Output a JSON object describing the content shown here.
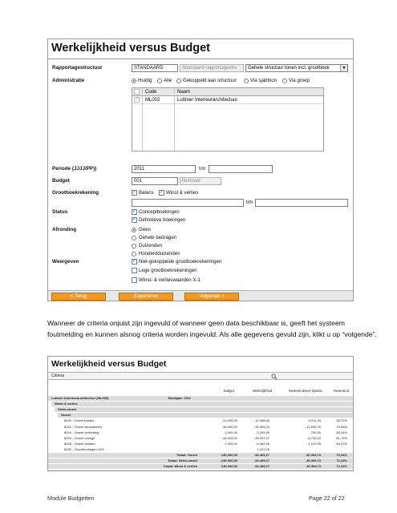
{
  "form": {
    "title": "Werkelijkheid versus Budget",
    "labels": {
      "rapportagestructuur": "Rapportagestructuur",
      "administratie": "Administratie",
      "periode": "Periode (JJJJ/PP))",
      "budget": "Budget",
      "grootboekrekening": "Grootboekrekening",
      "status": "Status",
      "afronding": "Afronding",
      "weergeven": "Weergeven"
    },
    "rapportagestructuur": {
      "code": "STANDAARD",
      "description": "Standaard rapportagestru",
      "option": "Gehele structuur tonen incl. grootboek"
    },
    "administratie_options": [
      "Huidig",
      "Alle",
      "Gekoppeld aan structuur",
      "Via sjabloon",
      "Via groep"
    ],
    "admin_grid": {
      "headers": [
        "Code",
        "Naam"
      ],
      "rows": [
        {
          "code": "ML002",
          "naam": "Luttmer Interieurarchitectuur"
        }
      ]
    },
    "periode": {
      "from": "2011",
      "to_label": "t/m"
    },
    "budget": {
      "code": "001",
      "name": "Normaal"
    },
    "grootboek": {
      "options": [
        "Balans",
        "Winst & verlies"
      ],
      "to_label": "t/m"
    },
    "status_options": [
      "Conceptboekingen",
      "Definitieve boekingen"
    ],
    "afronding_options": [
      "Geen",
      "Gehele bedragen",
      "Duizenden",
      "Honderdduizenden"
    ],
    "weergeven_options": [
      "Niet-gekoppelde grootboekrekeningen",
      "Lege grootboekrekeningen",
      "Winst- & verlieswaarden X-1"
    ],
    "buttons": {
      "back": "< Terug",
      "export": "Exporteren",
      "next": "Volgende >"
    }
  },
  "paragraph": [
    "Wanneer de criteria onjuist zijn ingevuld of wanneer geen data beschikbaar is, geeft het systeem",
    "foutmelding en kunnen alsnog criteria worden ingevuld. Als alle gegevens gevuld zijn, klikt u op “volgende”."
  ],
  "report": {
    "title": "Werkelijkheid versus Budget",
    "criteria_label": "Criteria",
    "columns": [
      "Budget",
      "Werkelijkheid",
      "Resterend/over tijdsste",
      "Resterend"
    ],
    "entity": {
      "name": "Luttmer Interieurarchitectuur (ML002)",
      "note": "Boekjaar: 2011"
    },
    "groups": [
      "Winst & verlies",
      "Netto-omzet",
      "Omzet"
    ],
    "rows": [
      {
        "label": "8020 - Omzet kasten",
        "budget": "-24.000,00",
        "actual": "-14.088,66",
        "diff": "-9.911,34",
        "pct": "58,70%"
      },
      {
        "label": "8022 - Omzet zitmeubelen",
        "budget": "-48.000,00",
        "actual": "-35.309,24",
        "diff": "-12.690,76",
        "pct": "73,56%"
      },
      {
        "label": "8024 - Omzet verlichting",
        "budget": "-3.000,00",
        "actual": "-2.205,50",
        "diff": "-794,50",
        "pct": "68,04%"
      },
      {
        "label": "8026 - Omzet overige",
        "budget": "-48.000,00",
        "actual": "-39.257,97",
        "diff": "-8.742,03",
        "pct": "81,79%"
      },
      {
        "label": "8028 - Omzet bedden",
        "budget": "-7.200,00",
        "actual": "-6.062,95",
        "diff": "-1.137,05",
        "pct": "84,21%"
      },
      {
        "label": "8030 - Omzetkortingen 10%",
        "budget": "",
        "actual": "2.437,05",
        "diff": "",
        "pct": ""
      }
    ],
    "totals": [
      {
        "label": "Totaal: Omzet",
        "budget": "-130.000,00",
        "actual": "-94.469,27",
        "diff": "-36.309,73",
        "pct": "72,24%"
      },
      {
        "label": "Totaal: Netto-omzet",
        "budget": "-130.000,00",
        "actual": "-94.469,27",
        "diff": "-36.309,73",
        "pct": "72,24%"
      },
      {
        "label": "Totaal: Winst & verlies",
        "budget": "-130.000,00",
        "actual": "-94.469,27",
        "diff": "-36.309,73",
        "pct": "72,24%"
      },
      {
        "label": "Totaal: Luttmer Interieurarchitectuur (ML002)",
        "budget": "-130.000,00",
        "actual": "-94.469,27",
        "diff": "-36.309,73",
        "pct": "72,24%"
      }
    ]
  },
  "footer": {
    "left": "Module Budgetten",
    "right": "Page 22 of 22"
  },
  "colors": {
    "button_orange": "#f29a1f",
    "row_shade": "#dcdcdc"
  }
}
